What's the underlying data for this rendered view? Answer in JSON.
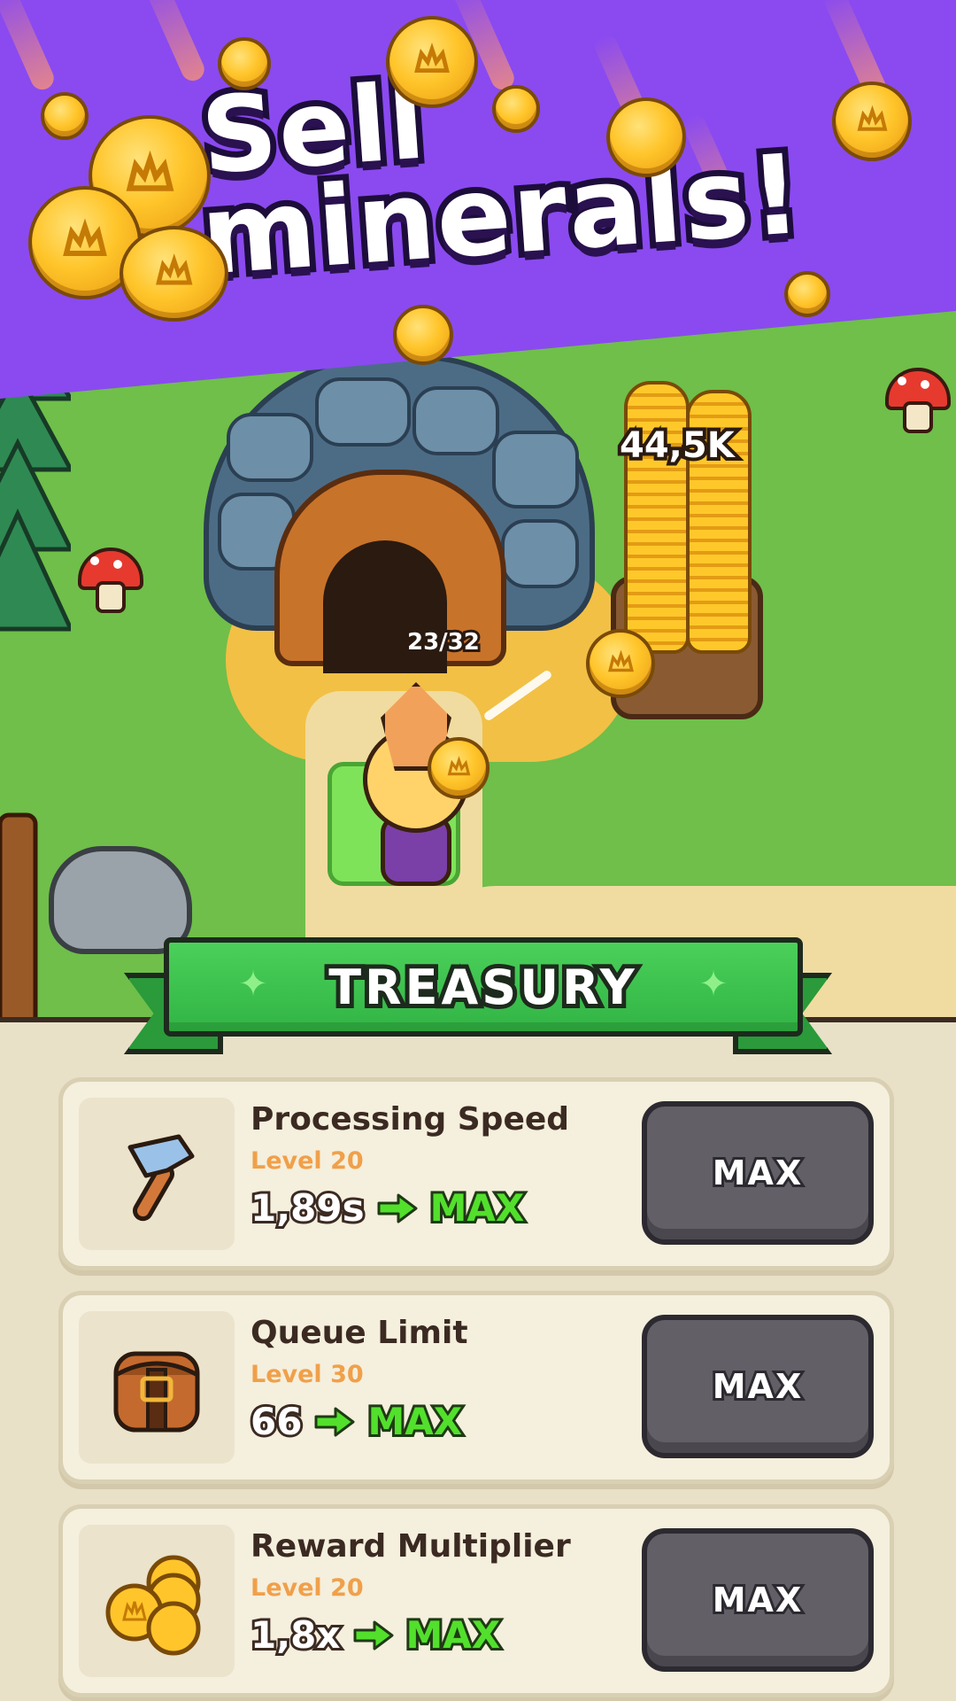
{
  "banner": {
    "headline_line1": "Sell",
    "headline_line2": "minerals!",
    "background_color": "#8a4af0"
  },
  "world": {
    "coin_stack_amount": "44,5K",
    "mine_cart_capacity": "23/32"
  },
  "treasury": {
    "title": "TREASURY",
    "upgrades": [
      {
        "name": "Processing Speed",
        "level": "Level 20",
        "current": "1,89s",
        "next": "MAX",
        "button_label": "MAX",
        "icon": "hammer-icon"
      },
      {
        "name": "Queue Limit",
        "level": "Level 30",
        "current": "66",
        "next": "MAX",
        "button_label": "MAX",
        "icon": "bag-icon"
      },
      {
        "name": "Reward Multiplier",
        "level": "Level 20",
        "current": "1,8x",
        "next": "MAX",
        "button_label": "MAX",
        "icon": "coins-icon"
      }
    ]
  },
  "colors": {
    "ribbon_green": "#31b444",
    "level_orange": "#f0a04a",
    "stat_green": "#52e02c",
    "button_gray": "#626066",
    "panel_beige": "#e9e0c8"
  }
}
